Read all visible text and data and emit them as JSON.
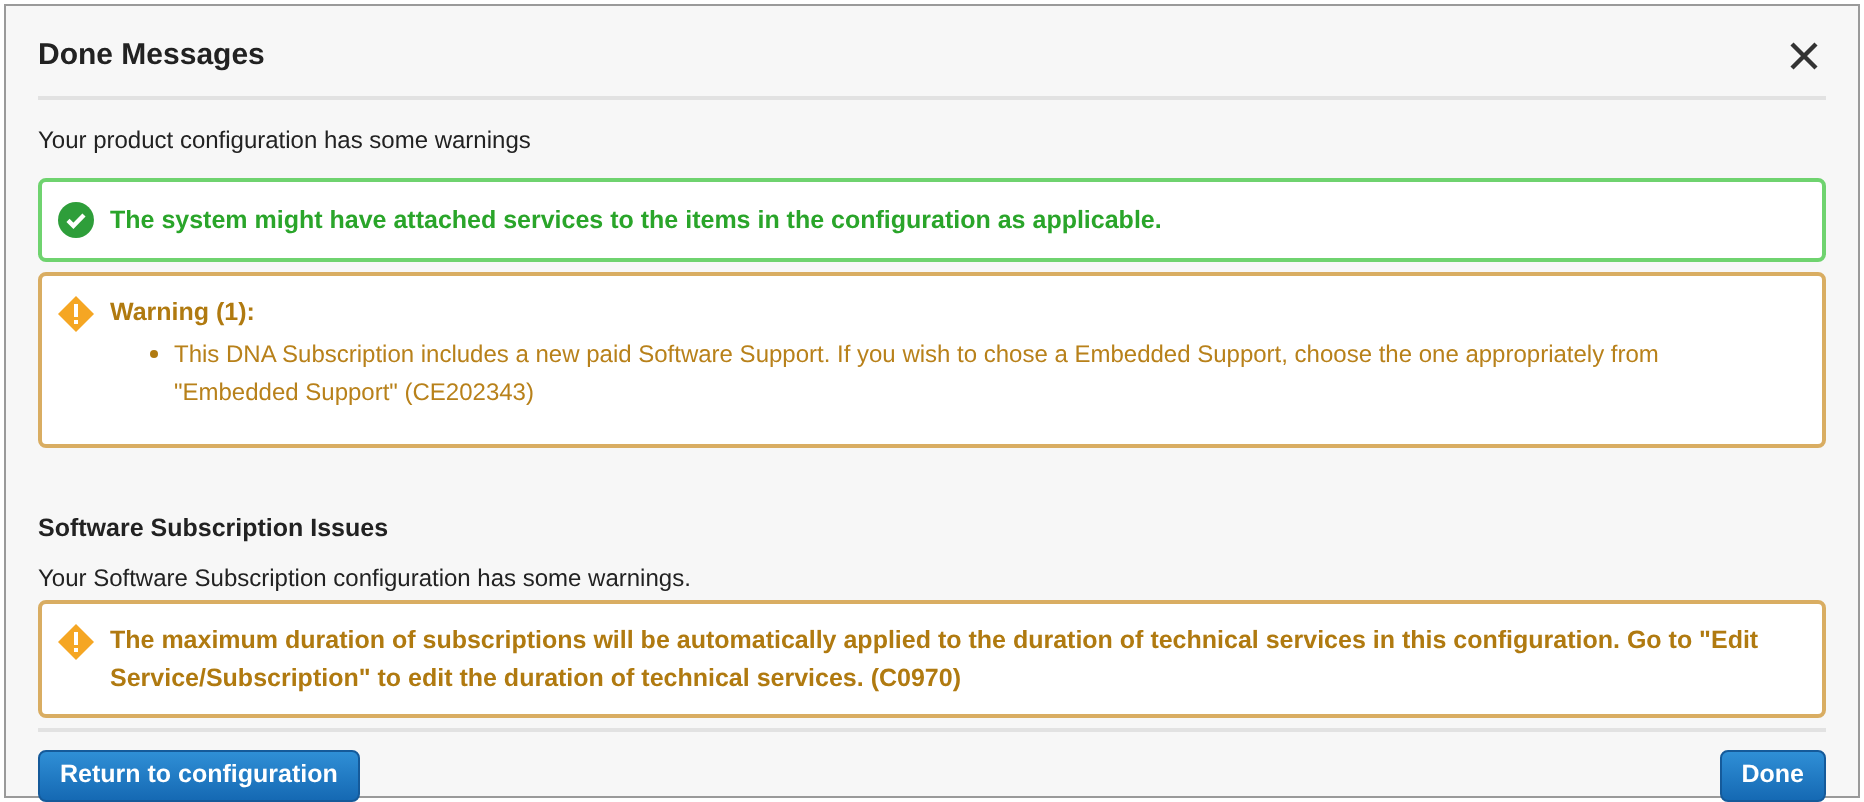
{
  "dialog": {
    "title": "Done Messages",
    "intro": "Your product configuration has some warnings",
    "messages": [
      {
        "kind": "success",
        "text": "The system might have attached services to the items in the configuration as applicable."
      },
      {
        "kind": "warning",
        "title": "Warning (1):",
        "items": [
          "This DNA Subscription includes a new paid Software Support. If you wish to chose a Embedded Support, choose the one appropriately from \"Embedded Support\" (CE202343)"
        ]
      }
    ],
    "sections": [
      {
        "title": "Software Subscription Issues",
        "subtitle": "Your Software Subscription configuration has some warnings.",
        "messages": [
          {
            "kind": "warning",
            "text": "The maximum duration of subscriptions will be automatically applied to the duration of technical services in this configuration. Go to \"Edit Service/Subscription\" to edit the duration of technical services. (C0970)"
          }
        ]
      }
    ],
    "buttons": [
      "Return to configuration",
      "Done"
    ]
  }
}
